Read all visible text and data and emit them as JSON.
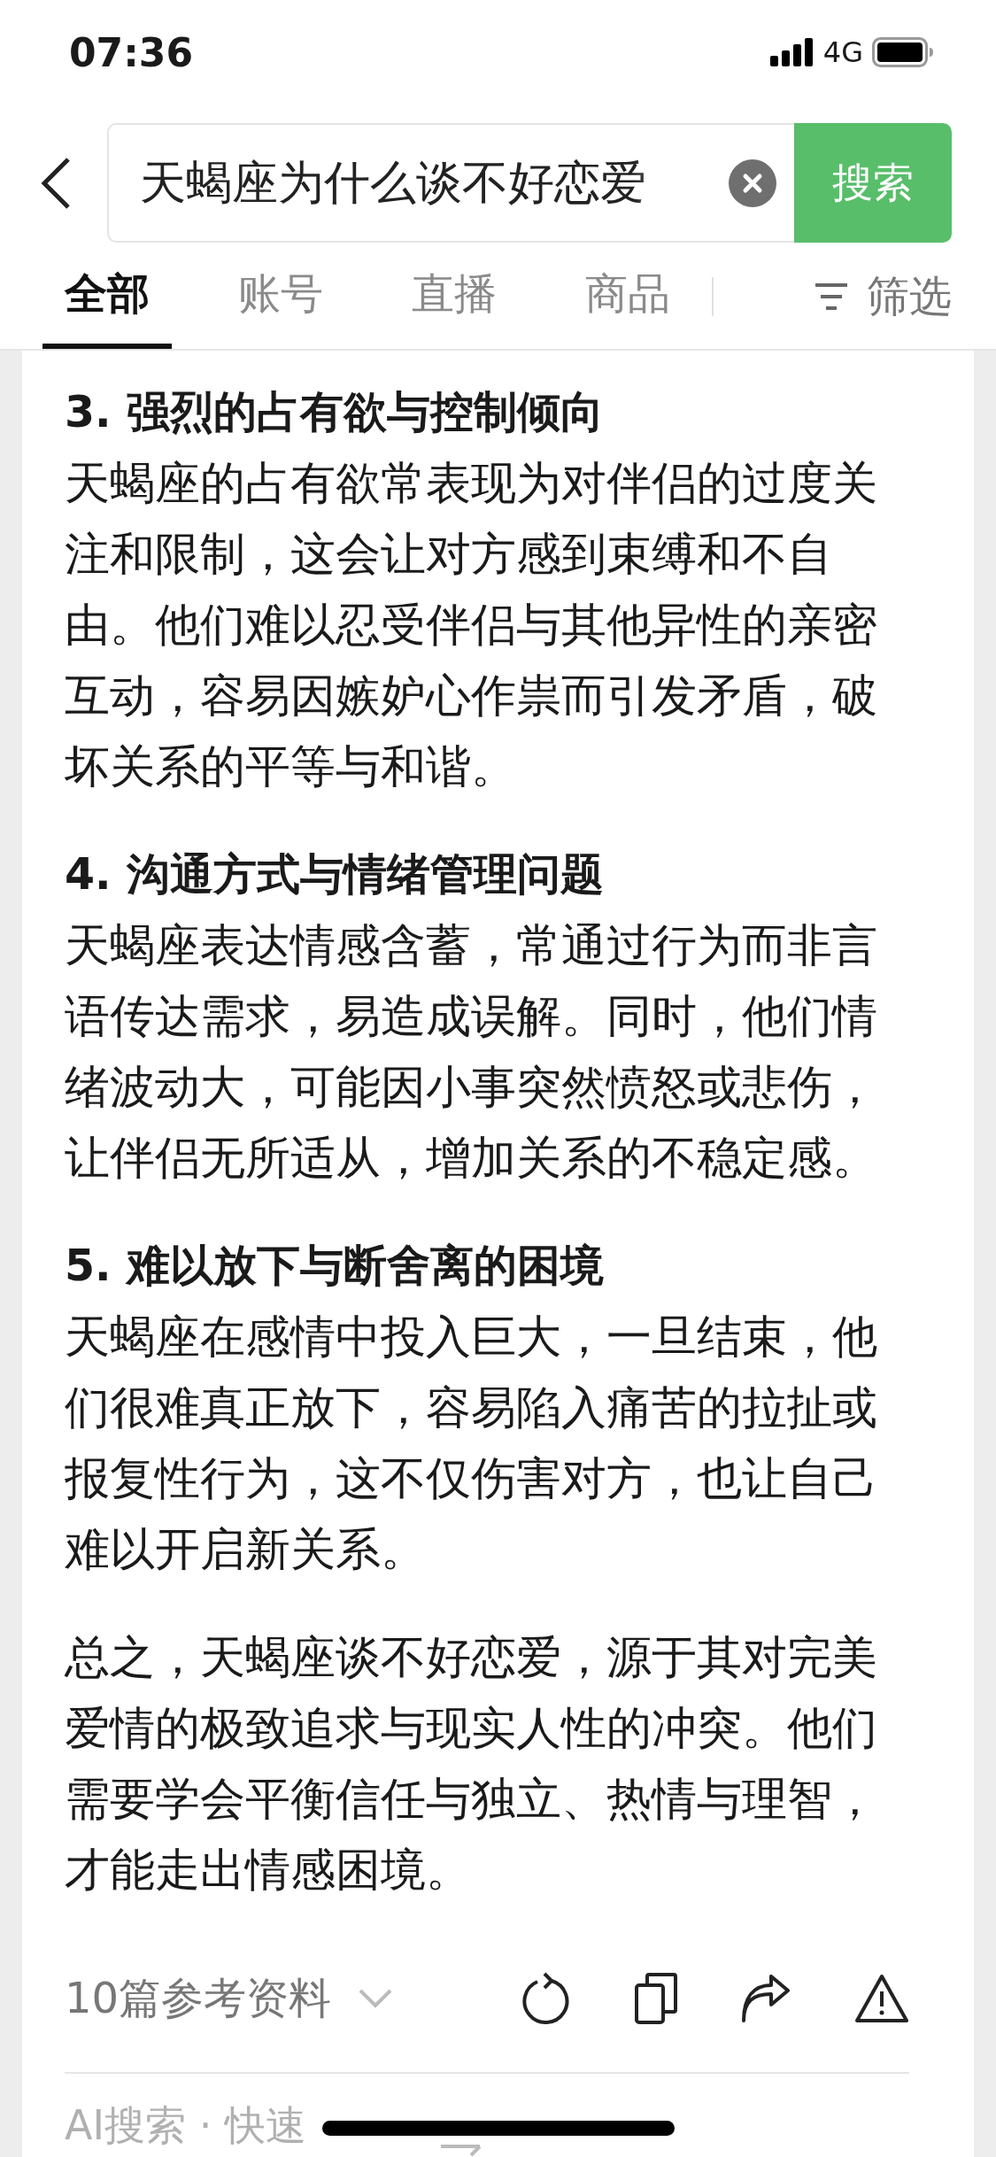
{
  "status_bar": {
    "time": "07:36",
    "network": "4G"
  },
  "search": {
    "value": "天蝎座为什么谈不好恋爱",
    "button": "搜索"
  },
  "tabs": [
    {
      "label": "全部",
      "selected": true
    },
    {
      "label": "账号",
      "selected": false
    },
    {
      "label": "直播",
      "selected": false
    },
    {
      "label": "商品",
      "selected": false
    }
  ],
  "filter": {
    "label": "筛选"
  },
  "sections": [
    {
      "heading": "3. 强烈的占有欲与控制倾向",
      "body": "天蝎座的占有欲常表现为对伴侣的过度关注和限制，这会让对方感到束缚和不自由。他们难以忍受伴侣与其他异性的亲密互动，容易因嫉妒心作祟而引发矛盾，破坏关系的平等与和谐。"
    },
    {
      "heading": "4. 沟通方式与情绪管理问题",
      "body": "天蝎座表达情感含蓄，常通过行为而非言语传达需求，易造成误解。同时，他们情绪波动大，可能因小事突然愤怒或悲伤，让伴侣无所适从，增加关系的不稳定感。"
    },
    {
      "heading": "5. 难以放下与断舍离的困境",
      "body": "天蝎座在感情中投入巨大，一旦结束，他们很难真正放下，容易陷入痛苦的拉扯或报复性行为，这不仅伤害对方，也让自己难以开启新关系。"
    }
  ],
  "summary": "总之，天蝎座谈不好恋爱，源于其对完美爱情的极致追求与现实人性的冲突。他们需要学会平衡信任与独立、热情与理智，才能走出情感困境。",
  "references": {
    "label": "10篇参考资料"
  },
  "footer_link": "AI搜索 · 快速"
}
